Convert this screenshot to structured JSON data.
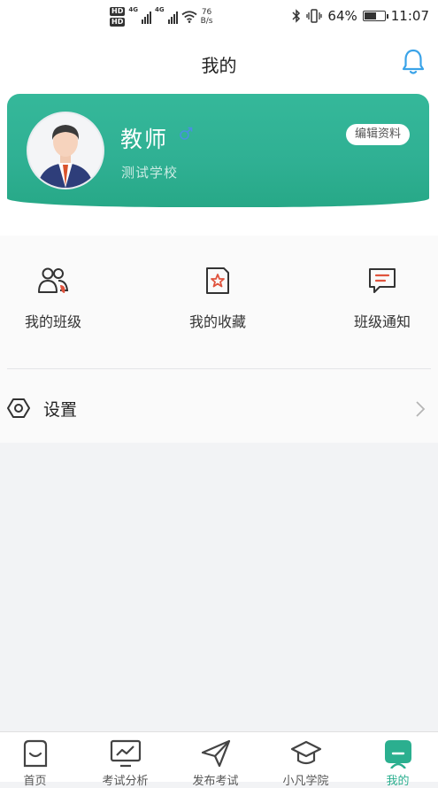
{
  "status_bar": {
    "hd1": "HD",
    "hd2": "HD",
    "net1": "4G",
    "net2": "4G",
    "speed_value": "76",
    "speed_unit": "B/s",
    "battery_percent": "64%",
    "battery_level": 0.64,
    "time": "11:07"
  },
  "header": {
    "title": "我的"
  },
  "profile": {
    "name": "教师",
    "school": "测试学校",
    "edit_label": "编辑资料"
  },
  "quick_actions": [
    {
      "label": "我的班级",
      "icon": "class-group-icon"
    },
    {
      "label": "我的收藏",
      "icon": "favorite-bookmark-icon"
    },
    {
      "label": "班级通知",
      "icon": "notice-message-icon"
    }
  ],
  "settings": {
    "label": "设置"
  },
  "tabs": [
    {
      "label": "首页",
      "icon": "home-icon"
    },
    {
      "label": "考试分析",
      "icon": "analysis-icon"
    },
    {
      "label": "发布考试",
      "icon": "send-icon"
    },
    {
      "label": "小凡学院",
      "icon": "graduation-cap-icon"
    },
    {
      "label": "我的",
      "icon": "profile-icon"
    }
  ],
  "colors": {
    "accent": "#2fb093",
    "bell": "#3aa3e8",
    "gender": "#4a90e2",
    "page_bg": "#f2f3f5"
  }
}
